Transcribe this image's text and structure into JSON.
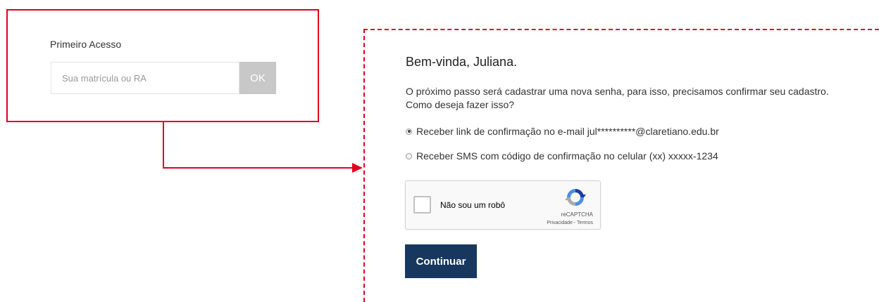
{
  "first_access": {
    "title": "Primeiro Acesso",
    "input_placeholder": "Sua matrícula ou RA",
    "input_value": "",
    "ok_label": "OK"
  },
  "confirmation": {
    "greeting": "Bem-vinda, Juliana.",
    "intro": "O próximo passo será cadastrar uma nova senha, para isso, precisamos confirmar seu cadastro.\nComo deseja fazer isso?",
    "options": [
      {
        "label": "Receber link de confirmação no e-mail jul**********@claretiano.edu.br",
        "selected": true
      },
      {
        "label": "Receber SMS com código de confirmação no celular (xx) xxxxx-1234",
        "selected": false
      }
    ],
    "recaptcha": {
      "label": "Não sou um robô",
      "brand": "reCAPTCHA",
      "privacy": "Privacidade",
      "separator": " - ",
      "terms": "Termos"
    },
    "continue_label": "Continuar"
  },
  "colors": {
    "highlight": "#e3001b",
    "primary_button": "#17375e",
    "ok_button": "#c8c8c8"
  },
  "icons": {
    "recaptcha_logo": "recaptcha-logo-icon",
    "arrow": "arrow-right-icon"
  }
}
